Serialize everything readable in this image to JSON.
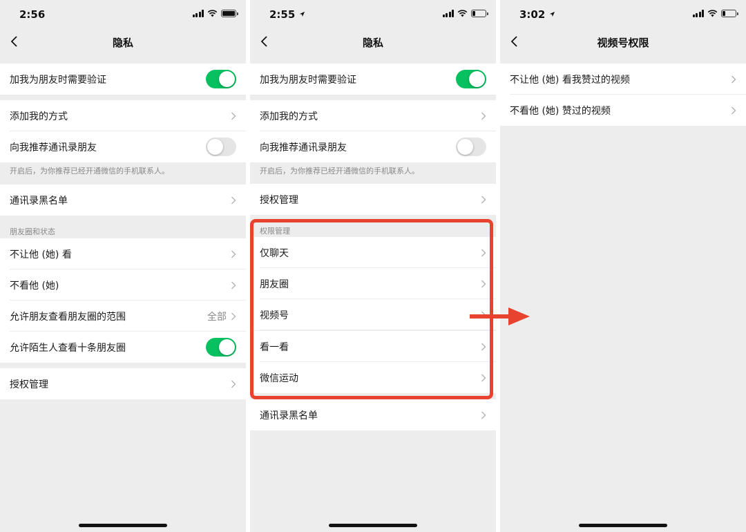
{
  "screens": [
    {
      "status_time": "2:56",
      "title": "隐私",
      "rows": {
        "friend_verify": "加我为朋友时需要验证",
        "add_methods": "添加我的方式",
        "recommend_contacts": "向我推荐通讯录朋友",
        "hint": "开启后，为你推荐已经开通微信的手机联系人。",
        "contacts_blacklist": "通讯录黑名单",
        "section_moments": "朋友圈和状态",
        "dont_let_see": "不让他 (她) 看",
        "dont_see": "不看他 (她)",
        "moments_range": "允许朋友查看朋友圈的范围",
        "moments_range_value": "全部",
        "stranger_ten": "允许陌生人查看十条朋友圈",
        "auth_manage": "授权管理"
      }
    },
    {
      "status_time": "2:55",
      "title": "隐私",
      "rows": {
        "friend_verify": "加我为朋友时需要验证",
        "add_methods": "添加我的方式",
        "recommend_contacts": "向我推荐通讯录朋友",
        "hint": "开启后，为你推荐已经开通微信的手机联系人。",
        "auth_manage": "授权管理",
        "section_permissions": "权限管理",
        "chat_only": "仅聊天",
        "moments": "朋友圈",
        "channels": "视频号",
        "top_stories": "看一看",
        "werun": "微信运动",
        "contacts_blacklist": "通讯录黑名单"
      }
    },
    {
      "status_time": "3:02",
      "title": "视频号权限",
      "rows": {
        "hide_my_likes": "不让他 (她) 看我赞过的视频",
        "hide_their_likes": "不看他 (她) 赞过的视频"
      }
    }
  ],
  "toggles": {
    "s1_friend_verify": "on",
    "s1_recommend_contacts": "off",
    "s1_stranger_ten": "on",
    "s2_friend_verify": "on",
    "s2_recommend_contacts": "off"
  },
  "colors": {
    "toggle_on": "#07c160",
    "background": "#ededed",
    "annotation": "#e8432f"
  },
  "icons": [
    "back-chevron-icon",
    "chevron-right-icon",
    "signal-icon",
    "wifi-icon",
    "battery-icon",
    "location-arrow-icon",
    "annotation-arrow-icon"
  ]
}
